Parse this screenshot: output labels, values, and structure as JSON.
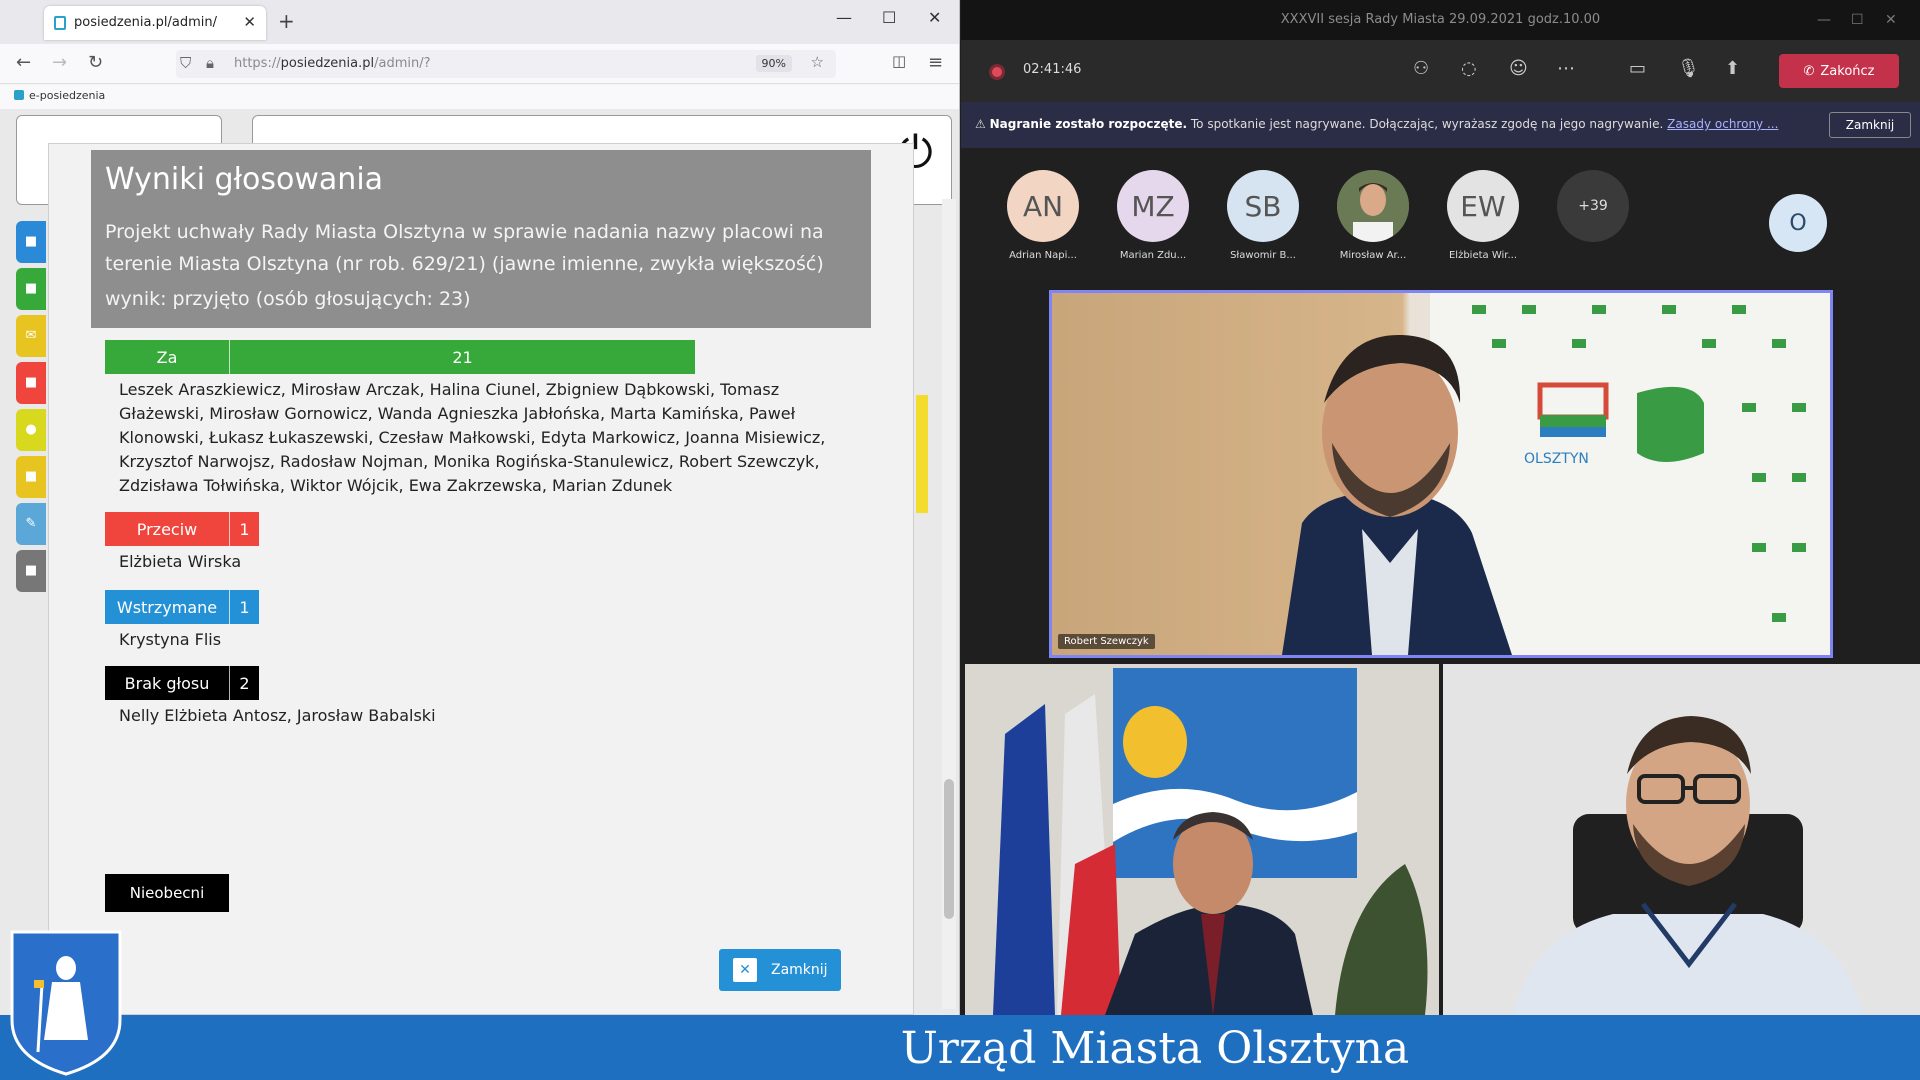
{
  "browser": {
    "tab_title": "posiedzenia.pl/admin/",
    "url_prefix": "https://",
    "url_domain": "posiedzenia.pl",
    "url_path": "/admin/?",
    "zoom": "90%",
    "bookmark": "e-posiedzenia"
  },
  "modal": {
    "title": "Wyniki głosowania",
    "subject": "Projekt uchwały Rady Miasta Olsztyna w sprawie nadania nazwy placowi na terenie Miasta Olsztyna (nr rob. 629/21) (jawne imienne, zwykła większość)",
    "result": "wynik: przyjęto (osób głosujących: 23)",
    "votes": [
      {
        "label": "Za",
        "count": "21",
        "color": "#36a93a",
        "names": "Leszek Araszkiewicz, Mirosław Arczak, Halina Ciunel, Zbigniew Dąbkowski, Tomasz Głażewski, Mirosław Gornowicz, Wanda Agnieszka Jabłońska, Marta Kamińska, Paweł Klonowski, Łukasz Łukaszewski, Czesław Małkowski, Edyta Markowicz, Joanna Misiewicz, Krzysztof Narwojsz, Radosław Nojman, Monika Rogińska-Stanulewicz, Robert Szewczyk, Zdzisława Tołwińska, Wiktor Wójcik, Ewa Zakrzewska, Marian Zdunek"
      },
      {
        "label": "Przeciw",
        "count": "1",
        "color": "#f0453c",
        "names": "Elżbieta Wirska"
      },
      {
        "label": "Wstrzymane",
        "count": "1",
        "color": "#2491d6",
        "names": "Krystyna Flis"
      },
      {
        "label": "Brak głosu",
        "count": "2",
        "color": "#000000",
        "names": "Nelly Elżbieta Antosz, Jarosław Babalski"
      }
    ],
    "absent_label": "Nieobecni",
    "close_label": "Zamknij"
  },
  "teams": {
    "window_title": "XXXVII sesja Rady Miasta 29.09.2021 godz.10.00",
    "timer": "02:41:46",
    "end_label": "Zakończ",
    "banner_bold": "Nagranie zostało rozpoczęte.",
    "banner_text": "To spotkanie jest nagrywane. Dołączając, wyrażasz zgodę na jego nagrywanie.",
    "banner_link": "Zasady ochrony ...",
    "banner_close": "Zamknij",
    "participants": [
      {
        "initials": "AN",
        "name": "Adrian Napi...",
        "color": "#f2d5c3"
      },
      {
        "initials": "MZ",
        "name": "Marian Zdu...",
        "color": "#e6d8ec"
      },
      {
        "initials": "SB",
        "name": "Sławomir B...",
        "color": "#d6e4f2"
      },
      {
        "initials": "",
        "name": "Mirosław Ar...",
        "color": "#6a7a55"
      },
      {
        "initials": "EW",
        "name": "Elżbieta Wir...",
        "color": "#e3e3e3"
      }
    ],
    "more_count": "+39",
    "self_initial": "O",
    "tile_main_name": "Robert Szewczyk"
  },
  "footer": {
    "title": "Urząd Miasta Olsztyna"
  }
}
